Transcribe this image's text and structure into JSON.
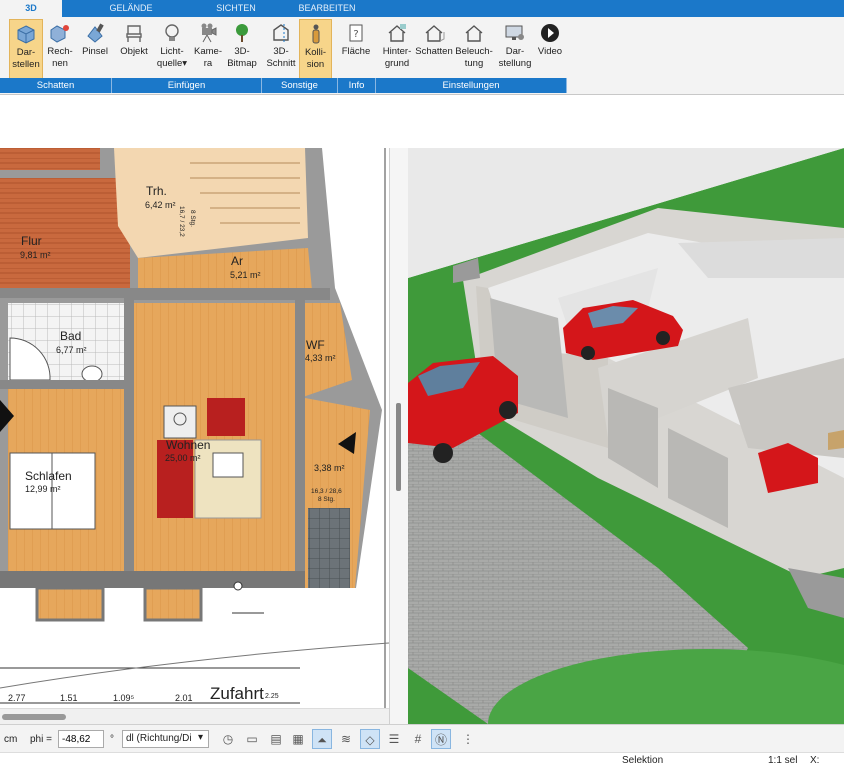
{
  "tabs": [
    "3D",
    "GELÄNDE",
    "SICHTEN",
    "BEARBEITEN"
  ],
  "ribbon": {
    "buttons": [
      {
        "l1": "Dar-",
        "l2": "stellen",
        "icon": "cube-icon"
      },
      {
        "l1": "Rech-",
        "l2": "nen",
        "icon": "render-icon"
      },
      {
        "l1": "Pinsel",
        "l2": "",
        "icon": "brush-icon"
      },
      {
        "l1": "Objekt",
        "l2": "",
        "icon": "chair-icon"
      },
      {
        "l1": "Licht-",
        "l2": "quelle",
        "icon": "bulb-icon"
      },
      {
        "l1": "Kame-",
        "l2": "ra",
        "icon": "camera-icon"
      },
      {
        "l1": "3D-",
        "l2": "Bitmap",
        "icon": "tree-icon"
      },
      {
        "l1": "3D-",
        "l2": "Schnitt",
        "icon": "cut-icon"
      },
      {
        "l1": "Kolli-",
        "l2": "sion",
        "icon": "person-icon"
      },
      {
        "l1": "Fläche",
        "l2": "",
        "icon": "area-info-icon"
      },
      {
        "l1": "Hinter-",
        "l2": "grund",
        "icon": "house-background-icon"
      },
      {
        "l1": "Schatten",
        "l2": "",
        "icon": "house-shadow-icon"
      },
      {
        "l1": "Beleuch-",
        "l2": "tung",
        "icon": "house-light-icon"
      },
      {
        "l1": "Dar-",
        "l2": "stellung",
        "icon": "monitor-settings-icon"
      },
      {
        "l1": "Video",
        "l2": "",
        "icon": "play-icon"
      }
    ],
    "groups": [
      "Schatten",
      "Einfügen",
      "Sonstige",
      "Info",
      "Einstellungen"
    ]
  },
  "plan": {
    "rooms": [
      {
        "name": "Trh.",
        "area": "6,42 m²"
      },
      {
        "name": "Flur",
        "area": "9,81 m²"
      },
      {
        "name": "Ar",
        "area": "5,21 m²"
      },
      {
        "name": "Bad",
        "area": "6,77 m²"
      },
      {
        "name": "WF",
        "area": "4,33 m²"
      },
      {
        "name": "Wohnen",
        "area": "25,00 m²"
      },
      {
        "name": "Schlafen",
        "area": "12,99 m²"
      },
      {
        "name": "",
        "area": "3,38 m²"
      }
    ],
    "stair_upper": [
      "16,7 / 23,2",
      "8 Stg."
    ],
    "stair_lower": [
      "16,3 / 28,6",
      "8 Stg."
    ],
    "dims": [
      "2.77",
      "1.51",
      "1.09⁵",
      "2.01",
      "2.25"
    ],
    "label_street": "Zufahrt"
  },
  "status": {
    "unit": "cm",
    "phi_label": "phi =",
    "phi_value": "-48,62",
    "deg": "°",
    "direction": "dl (Richtung/Di",
    "tools": [
      "clock-icon",
      "monitor-icon",
      "layers-icon",
      "terrain-icon",
      "grid-icon",
      "hatch-icon",
      "plane-icon",
      "stack-icon",
      "raster-icon",
      "north-icon",
      "more-icon"
    ]
  },
  "bottom": {
    "mode": "Selektion",
    "scale": "1:1 sel",
    "x_label": "X:"
  },
  "colors": {
    "accent": "#1b78c9",
    "floor": "#e3a55a",
    "tiles": "#c9693e",
    "grass": "#3f9a3a",
    "car": "#d4161a"
  }
}
